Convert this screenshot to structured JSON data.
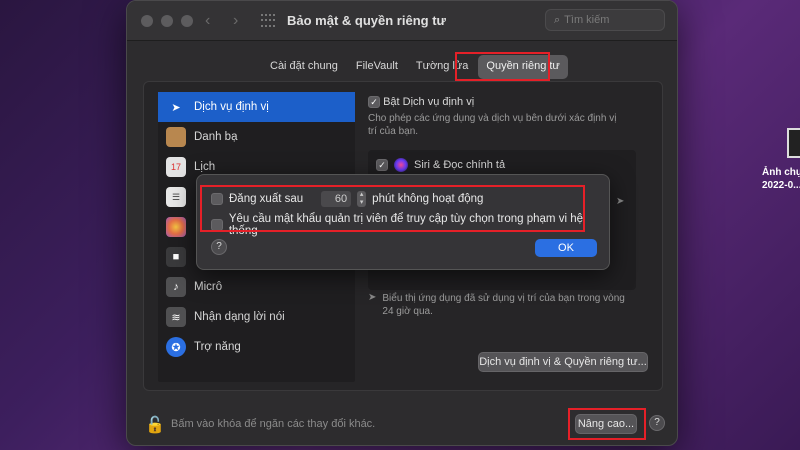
{
  "window": {
    "title": "Bảo mật & quyền riêng tư",
    "search_placeholder": "Tìm kiếm"
  },
  "tabs": [
    {
      "label": "Cài đặt chung"
    },
    {
      "label": "FileVault"
    },
    {
      "label": "Tường lửa"
    },
    {
      "label": "Quyền riêng tư",
      "active": true
    }
  ],
  "sidebar": {
    "items": [
      {
        "label": "Dịch vụ định vị",
        "icon": "location-arrow-icon",
        "color": "#2b6fe2",
        "selected": true
      },
      {
        "label": "Danh bạ",
        "icon": "contacts-icon",
        "color": "#b8874f"
      },
      {
        "label": "Lịch",
        "icon": "calendar-icon",
        "color": "#e4e4e4"
      },
      {
        "label": "",
        "icon": "reminders-icon",
        "color": "#e8e8e8"
      },
      {
        "label": "",
        "icon": "photos-icon",
        "color": "#e56e46"
      },
      {
        "label": "",
        "icon": "camera-icon",
        "color": "#3a3a3c"
      },
      {
        "label": "Micrô",
        "icon": "microphone-icon",
        "color": "#505052"
      },
      {
        "label": "Nhận dạng lời nói",
        "icon": "waveform-icon",
        "color": "#505052"
      },
      {
        "label": "Trợ năng",
        "icon": "accessibility-icon",
        "color": "#2b6fe2"
      }
    ]
  },
  "location": {
    "enable_label": "Bật Dịch vụ định vị",
    "description": "Cho phép các ứng dụng và dịch vụ bên dưới xác định vị trí của bạn.",
    "apps": [
      {
        "label": "Siri & Đọc chính tả",
        "checked": true
      }
    ],
    "recent_note": "Biểu thị ứng dụng đã sử dụng vị trí của bạn trong vòng 24 giờ qua.",
    "details_button": "Dịch vụ định vị & Quyền riêng tư..."
  },
  "footer": {
    "lock_text": "Bấm vào khóa để ngăn các thay đổi khác.",
    "advanced_button": "Nâng cao..."
  },
  "advanced_sheet": {
    "logout_prefix": "Đăng xuất sau",
    "logout_minutes": "60",
    "logout_suffix": "phút không hoạt động",
    "admin_password_label": "Yêu cầu mật khẩu quản trị viên để truy cập tùy chọn trong phạm vi hệ thống",
    "ok_button": "OK"
  },
  "desktop": {
    "file_label_1": "Ảnh chụp",
    "file_label_2": "2022-0..."
  },
  "colors": {
    "accent": "#2b6fe2",
    "highlight_box": "#e52028"
  }
}
